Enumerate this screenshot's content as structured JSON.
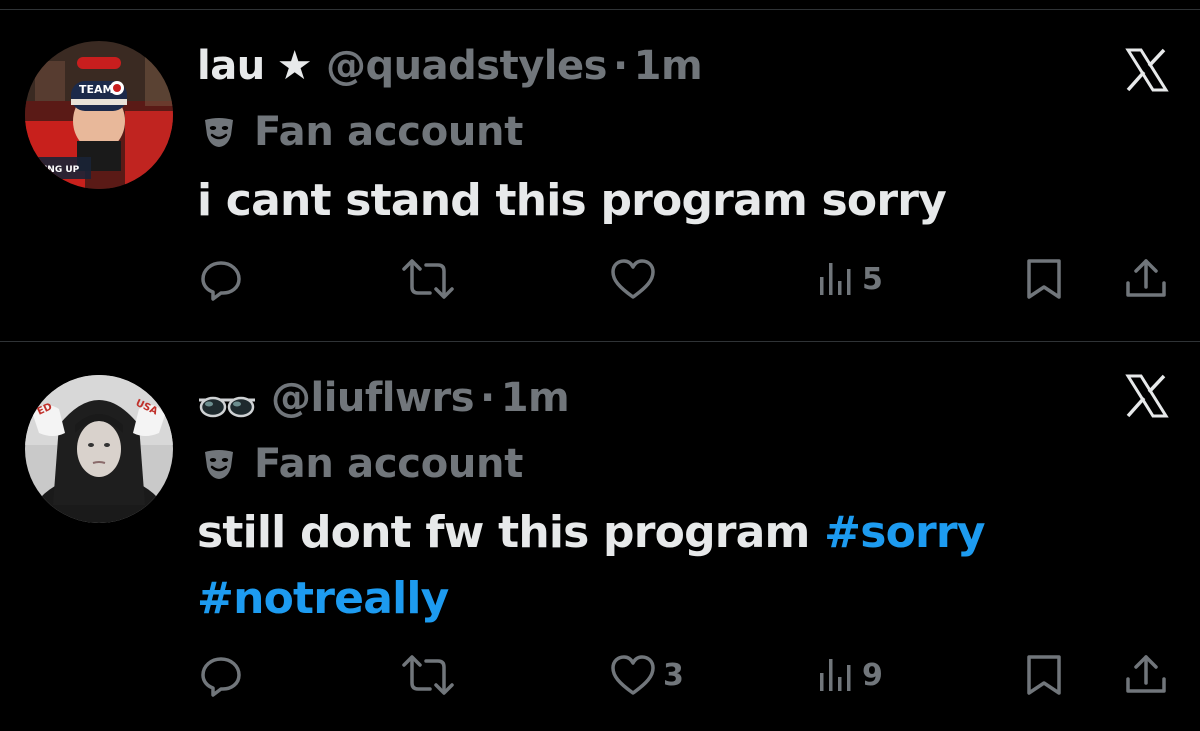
{
  "colors": {
    "background": "#000000",
    "text": "#e7e9ea",
    "muted": "#71767b",
    "divider": "#2f3336",
    "hashtag": "#1d9bf0"
  },
  "tweets": [
    {
      "display_name": "lau",
      "name_suffix_icon": "star-icon",
      "handle": "@quadstyles",
      "separator": "·",
      "time": "1m",
      "label_icon": "theater-mask-icon",
      "label": "Fan account",
      "text": "i cant stand this program sorry",
      "avatar_text": [
        "TEAM",
        "MING UP"
      ],
      "actions": {
        "reply_count": "",
        "retweet_count": "",
        "like_count": "",
        "views_count": "5"
      }
    },
    {
      "display_name": "",
      "name_prefix_icon": "sunglasses-emoji-icon",
      "handle": "@liuflwrs",
      "separator": "·",
      "time": "1m",
      "label_icon": "theater-mask-icon",
      "label": "Fan account",
      "text_plain": "still dont fw this program",
      "hashtags": [
        "#sorry",
        "#notreally"
      ],
      "avatar_text": [
        "USA",
        "ED"
      ],
      "actions": {
        "reply_count": "",
        "retweet_count": "",
        "like_count": "3",
        "views_count": "9"
      }
    }
  ]
}
